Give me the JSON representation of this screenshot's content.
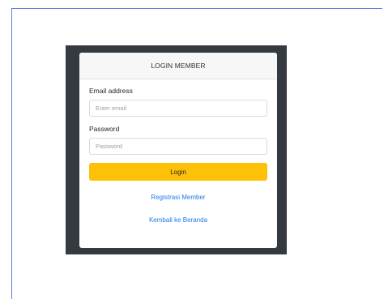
{
  "login": {
    "header": "LOGIN MEMBER",
    "email_label": "Email address",
    "email_placeholder": "Enter email",
    "email_value": "",
    "password_label": "Password",
    "password_placeholder": "Password",
    "password_value": "",
    "submit_label": "Login",
    "register_link": "Registrasi Member",
    "home_link": "Kembali ke Beranda"
  },
  "colors": {
    "rule": "#5c7fe0",
    "backdrop": "#343a40",
    "button": "#ffc107",
    "link": "#1e7be6"
  }
}
